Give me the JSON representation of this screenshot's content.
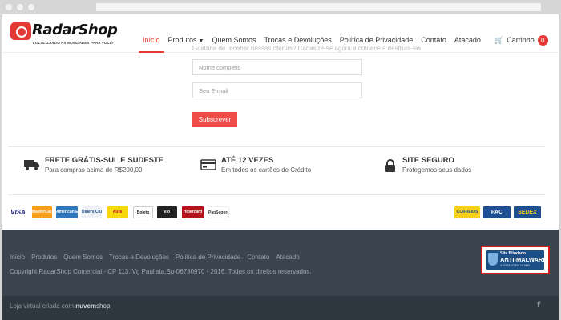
{
  "brand": {
    "name": "RadarShop",
    "tagline": "LOCALIZANDO AS NOVIDADES PARA VOCÊ!"
  },
  "nav": {
    "items": [
      {
        "label": "Início",
        "active": true
      },
      {
        "label": "Produtos",
        "dropdown": true
      },
      {
        "label": "Quem Somos"
      },
      {
        "label": "Trocas e Devoluções"
      },
      {
        "label": "Política de Privacidade"
      },
      {
        "label": "Contato"
      },
      {
        "label": "Atacado"
      }
    ],
    "cart_label": "Carrinho",
    "cart_count": "0"
  },
  "newsletter": {
    "intro": "Gostaria de receber nossas ofertas? Cadastre-se agora e comece a desfrutá-las!",
    "name_placeholder": "Nome completo",
    "email_placeholder": "Seu E-mail",
    "submit_label": "Subscrever"
  },
  "features": [
    {
      "icon": "truck-icon",
      "title": "FRETE GRÁTIS-SUL E SUDESTE",
      "subtitle": "Para compras acima de R$200,00"
    },
    {
      "icon": "credit-card-icon",
      "title": "ATÉ 12 VEZES",
      "subtitle": "Em todos os cartões de Crédito"
    },
    {
      "icon": "lock-icon",
      "title": "SITE SEGURO",
      "subtitle": "Protegemos seus dados"
    }
  ],
  "payments": [
    "VISA",
    "MasterCard",
    "American Express",
    "Diners Club",
    "Aura",
    "Boleto",
    "elo",
    "Hipercard",
    "PagSeguro"
  ],
  "shipping": [
    "CORREIOS",
    "PAC",
    "SEDEX"
  ],
  "footer": {
    "links": [
      "Início",
      "Produtos",
      "Quem Somos",
      "Trocas e Devoluções",
      "Política de Privacidade",
      "Contato",
      "Atacado"
    ],
    "copyright": "Copyright RadarShop Comercial - CP 113, Vg Paulista,Sp-06730970 - 2016. Todos os direitos reservados.",
    "seal": {
      "top": "Site Blindado",
      "main": "ANTI-MALWARE",
      "bottom": "AUDITADO EM 10 ABR"
    },
    "powered_prefix": "Loja virtual criada com",
    "powered_brand_a": "nuvem",
    "powered_brand_b": "shop",
    "social": "f"
  },
  "colors": {
    "accent": "#e53935",
    "footer_bg": "#3b4550",
    "bottom_bg": "#2f3741"
  }
}
